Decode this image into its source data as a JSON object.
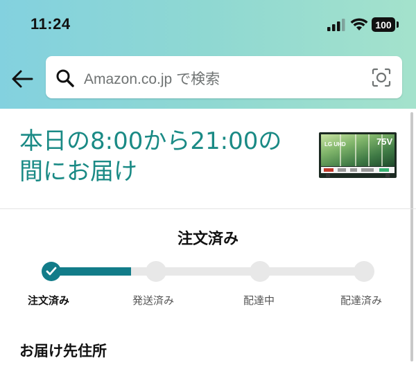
{
  "status_bar": {
    "time": "11:24",
    "battery": "100",
    "icons": [
      "cellular-signal-icon",
      "wifi-icon",
      "battery-icon"
    ]
  },
  "search": {
    "placeholder": "Amazon.co.jp で検索",
    "icons": [
      "back-arrow-icon",
      "search-icon",
      "camera-icon"
    ]
  },
  "delivery": {
    "line1": "本日の8:00から21:00の",
    "line2": "間にお届け",
    "color": "#1a8a85"
  },
  "product_thumbnail": {
    "brand_text": "LG UHD",
    "size_text": "75V"
  },
  "order_status": {
    "title": "注文済み",
    "accent_color": "#127c89",
    "progress": 0.25,
    "steps": [
      {
        "label": "注文済み",
        "done": true
      },
      {
        "label": "発送済み",
        "done": false
      },
      {
        "label": "配達中",
        "done": false
      },
      {
        "label": "配達済み",
        "done": false
      }
    ]
  },
  "address": {
    "heading": "お届け先住所"
  }
}
